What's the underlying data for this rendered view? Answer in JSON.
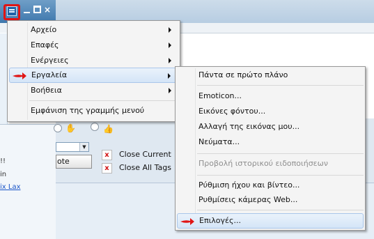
{
  "window": {
    "titlebar_buttons": [
      "minimize-icon",
      "maximize-icon",
      "close-icon"
    ],
    "close_glyph": "×"
  },
  "sidebar": {
    "text1": "!!",
    "text2": "in",
    "link": "ix Lax"
  },
  "toolbar": {
    "note_button": "ote",
    "close_current": "Close Current",
    "close_all": "Close All Tags"
  },
  "menu": {
    "items": [
      {
        "label": "Αρχείο",
        "submenu": true
      },
      {
        "label": "Επαφές",
        "submenu": true
      },
      {
        "label": "Ενέργειες",
        "submenu": true
      },
      {
        "label": "Εργαλεία",
        "submenu": true,
        "highlighted": true
      },
      {
        "label": "Βοήθεια",
        "submenu": true
      },
      {
        "label": "Εμφάνιση της γραμμής μενού",
        "submenu": false
      }
    ]
  },
  "submenu": {
    "items": [
      {
        "label": "Πάντα σε πρώτο πλάνο"
      },
      {
        "label": "Emoticon..."
      },
      {
        "label": "Εικόνες φόντου..."
      },
      {
        "label": "Αλλαγή της εικόνας μου..."
      },
      {
        "label": "Νεύματα..."
      },
      {
        "label": "Προβολή ιστορικού ειδοποιήσεων",
        "disabled": true
      },
      {
        "label": "Ρύθμιση ήχου και βίντεο..."
      },
      {
        "label": "Ρυθμίσεις κάμερας Web..."
      },
      {
        "label": "Επιλογές...",
        "highlighted": true
      }
    ]
  },
  "colors": {
    "annotation_red": "#e01515",
    "highlight_blue": "#d4e5f7"
  }
}
